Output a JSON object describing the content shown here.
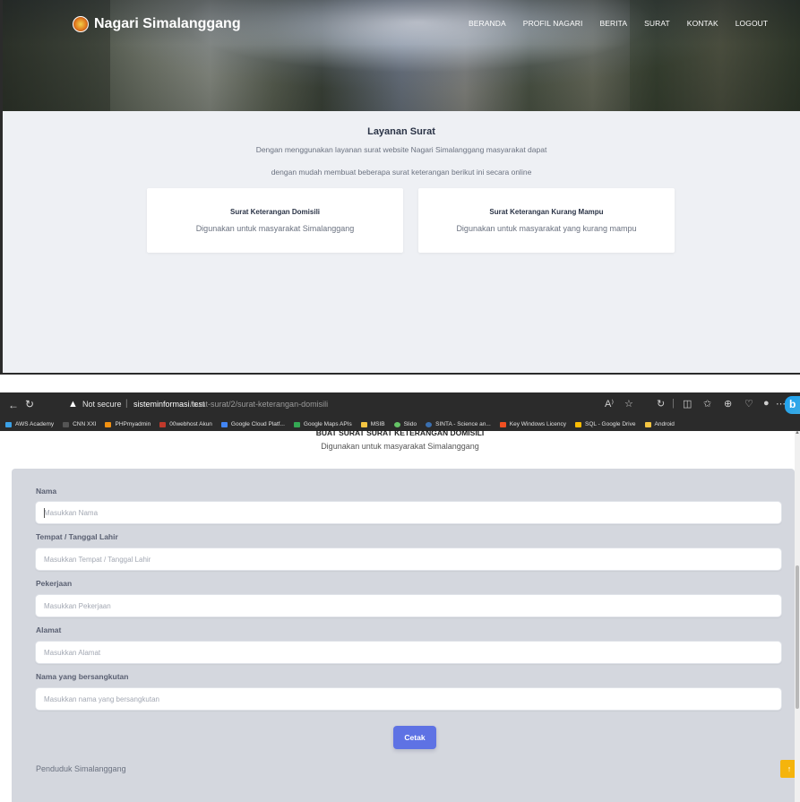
{
  "site": {
    "brand": "Nagari Simalanggang",
    "nav": [
      "BERANDA",
      "PROFIL NAGARI",
      "BERITA",
      "SURAT",
      "KONTAK",
      "LOGOUT"
    ]
  },
  "layanan": {
    "title": "Layanan Surat",
    "desc_line1": "Dengan menggunakan layanan surat website Nagari Simalanggang masyarakat dapat",
    "desc_line2": "dengan mudah membuat beberapa surat keterangan berikut ini secara online",
    "cards": [
      {
        "title": "Surat Keterangan Domisili",
        "desc": "Digunakan untuk masyarakat Simalanggang"
      },
      {
        "title": "Surat Keterangan Kurang Mampu",
        "desc": "Digunakan untuk masyarakat yang kurang mampu"
      }
    ]
  },
  "browser": {
    "security_label": "Not secure",
    "url_host": "sisteminformasi.test",
    "url_path": "/buat-surat/2/surat-keterangan-domisili",
    "bookmarks": [
      {
        "label": "AWS Academy",
        "color": "#3aa0e6"
      },
      {
        "label": "CNN XXI",
        "color": "#555555"
      },
      {
        "label": "PHPmyadmin",
        "color": "#f29111"
      },
      {
        "label": "00webhost Akun",
        "color": "#c0392b"
      },
      {
        "label": "Google Cloud Platf...",
        "color": "#4285f4"
      },
      {
        "label": "Google Maps APIs",
        "color": "#34a853"
      },
      {
        "label": "MSIB",
        "color": "#f5c542"
      },
      {
        "label": "Slido",
        "color": "#65c466"
      },
      {
        "label": "SINTA - Science an...",
        "color": "#3a6fb0"
      },
      {
        "label": "Key Windows Licency",
        "color": "#f25022"
      },
      {
        "label": "SQL - Google Drive",
        "color": "#fbbc04"
      },
      {
        "label": "Android",
        "color": "#f5c542"
      }
    ]
  },
  "form": {
    "heading": "BUAT SURAT SURAT KETERANGAN DOMISILI",
    "subheading": "Digunakan untuk masyarakat Simalanggang",
    "fields": [
      {
        "label": "Nama",
        "placeholder": "Masukkan Nama"
      },
      {
        "label": "Tempat / Tanggal Lahir",
        "placeholder": "Masukkan Tempat / Tanggal Lahir"
      },
      {
        "label": "Pekerjaan",
        "placeholder": "Masukkan Pekerjaan"
      },
      {
        "label": "Alamat",
        "placeholder": "Masukkan Alamat"
      },
      {
        "label": "Nama yang bersangkutan",
        "placeholder": "Masukkan nama yang bersangkutan"
      }
    ],
    "submit_label": "Cetak",
    "footer": "Penduduk Simalanggang"
  }
}
